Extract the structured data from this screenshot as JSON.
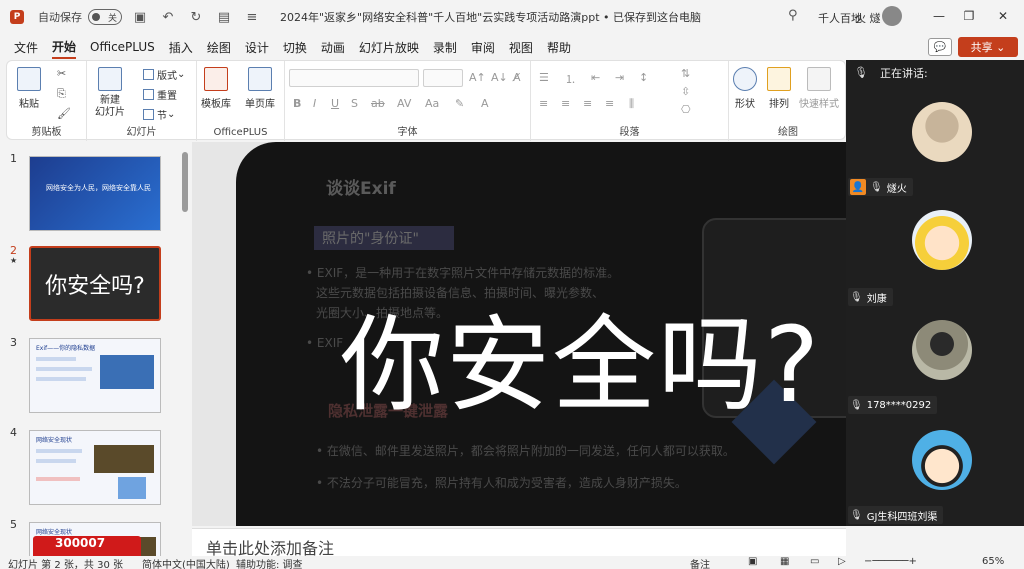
{
  "app": {
    "logo": "P",
    "autosave_label": "自动保存",
    "autosave_state": "关",
    "doc_title": "2024年\"返家乡\"网络安全科普\"千人百地\"云实践专项活动路演ppt • 已保存到这台电脑",
    "title_tip": "千人百地",
    "user_name": "火 燧"
  },
  "menu": [
    "文件",
    "开始",
    "OfficePLUS",
    "插入",
    "绘图",
    "设计",
    "切换",
    "动画",
    "幻灯片放映",
    "录制",
    "审阅",
    "视图",
    "帮助"
  ],
  "share_label": "共享",
  "ribbon": {
    "paste": "粘贴",
    "clipboard_label": "剪贴板",
    "new_slide": "新建\n幻灯片",
    "layout": "版式",
    "reset": "重置",
    "section": "节",
    "slides_label": "幻灯片",
    "template_lib": "模板库",
    "single_page_lib": "单页库",
    "officeplus_label": "OfficePLUS",
    "font_label": "字体",
    "paragraph_label": "段落",
    "shape": "形状",
    "arrange": "排列",
    "quick_style": "快速样式",
    "drawing_label": "绘图"
  },
  "slides": [
    {
      "num": "1",
      "title": "网络安全为人民，网络安全靠人民"
    },
    {
      "num": "2",
      "text": "你安全吗?",
      "marker": "★"
    },
    {
      "num": "3",
      "title": "Exif——你的隐私数据"
    },
    {
      "num": "4",
      "title": "网络安全现状"
    },
    {
      "num": "5",
      "title": "网络安全现状",
      "label": "300007"
    }
  ],
  "main_slide": {
    "big_text": "你安全吗?",
    "ghost_title": "谈谈Exif",
    "ghost_chip": "照片的\"身份证\"",
    "ghost_line1": "• EXIF，是一种用于在数字照片文件中存储元数据的标准。",
    "ghost_line2": "这些元数据包括拍摄设备信息、拍摄时间、曝光参数、",
    "ghost_line3": "光圈大小、拍摄地点等。",
    "ghost_line4": "• EXIF",
    "ghost_section": "隐私泄露一键泄露",
    "ghost_line5": "• 在微信、邮件里发送照片，都会将照片附加的一同发送，任何人都可以获取。",
    "ghost_line6": "• 不法分子可能冒充，照片持有人和成为受害者，造成人身财产损失。"
  },
  "notes_placeholder": "单击此处添加备注",
  "meeting": {
    "header": "正在讲话:",
    "participants": [
      {
        "name": "燧火",
        "host": true
      },
      {
        "name": "刘康"
      },
      {
        "name": "178****0292"
      },
      {
        "name": "GJ生科四班刘渠"
      }
    ]
  },
  "status": {
    "slide_info": "幻灯片 第 2 张，共 30 张",
    "language": "简体中文(中国大陆)",
    "accessibility": "辅助功能: 调查",
    "notes": "备注",
    "zoom": "65%"
  }
}
